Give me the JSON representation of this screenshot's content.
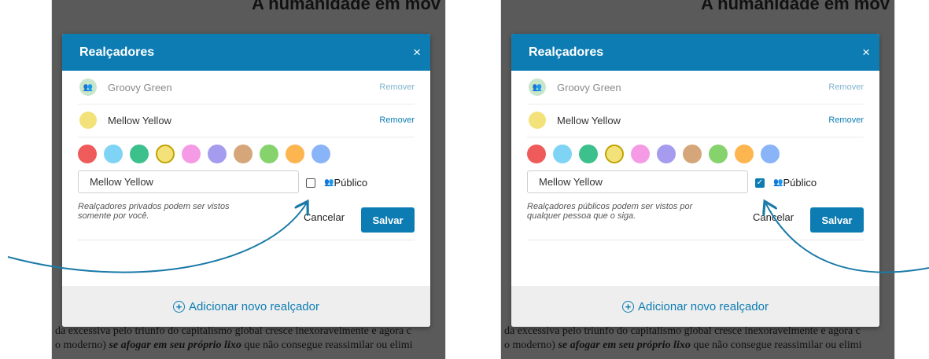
{
  "background": {
    "heading": "A humanidade em mov",
    "line1": "da excessiva pelo triunfo do capitalismo global cresce inexoravelmente e agora c",
    "line2_prefix": "o moderno) ",
    "line2_emphasis": "se afogar em seu próprio lixo",
    "line2_suffix": " que não consegue reassimilar ou elimi"
  },
  "panels": [
    {
      "dialog_title": "Realçadores",
      "close_glyph": "×",
      "highlighters": [
        {
          "name": "Groovy Green",
          "remove_label": "Remover",
          "color": "#c8e6c9",
          "icon": "people-icon"
        },
        {
          "name": "Mellow Yellow",
          "remove_label": "Remover",
          "color": "#f3e27a",
          "icon": ""
        }
      ],
      "palette": [
        "#ef5b5b",
        "#7fd4f5",
        "#3cc08c",
        "#f3e27a",
        "#f59ae4",
        "#a59cf0",
        "#d5a679",
        "#86d36e",
        "#fdb550",
        "#8ab4f8"
      ],
      "selected_color_index": 3,
      "name_value": "Mellow Yellow",
      "public_checked": false,
      "public_label": "Público",
      "note": "Realçadores privados podem ser vistos somente por você.",
      "cancel_label": "Cancelar",
      "save_label": "Salvar",
      "add_label": "Adicionar novo realçador"
    },
    {
      "dialog_title": "Realçadores",
      "close_glyph": "×",
      "highlighters": [
        {
          "name": "Groovy Green",
          "remove_label": "Remover",
          "color": "#c8e6c9",
          "icon": "people-icon"
        },
        {
          "name": "Mellow Yellow",
          "remove_label": "Remover",
          "color": "#f3e27a",
          "icon": ""
        }
      ],
      "palette": [
        "#ef5b5b",
        "#7fd4f5",
        "#3cc08c",
        "#f3e27a",
        "#f59ae4",
        "#a59cf0",
        "#d5a679",
        "#86d36e",
        "#fdb550",
        "#8ab4f8"
      ],
      "selected_color_index": 3,
      "name_value": "Mellow Yellow",
      "public_checked": true,
      "public_label": "Público",
      "note": "Realçadores públicos podem ser vistos por qualquer pessoa que o siga.",
      "cancel_label": "Cancelar",
      "save_label": "Salvar",
      "add_label": "Adicionar novo realçador"
    }
  ],
  "colors": {
    "accent": "#0d7cb2",
    "arrow": "#1a7aa8"
  }
}
